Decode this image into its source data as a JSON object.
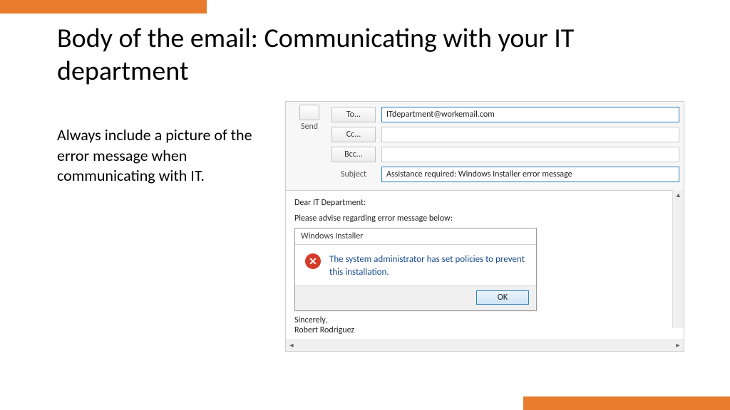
{
  "slide": {
    "title": "Body of the email: Communicating with your IT department",
    "body": "Always include a picture of the error message when communicating with IT."
  },
  "email": {
    "send_label": "Send",
    "to_label": "To...",
    "cc_label": "Cc...",
    "bcc_label": "Bcc...",
    "subject_label": "Subject",
    "to_value": "ITdepartment@workemail.com",
    "cc_value": "",
    "bcc_value": "",
    "subject_value": "Assistance required: Windows Installer error message",
    "body_line1": "Dear IT Department:",
    "body_line2": "Please advise regarding error message below:",
    "sign1": "Sincerely,",
    "sign2": "Robert Rodriguez"
  },
  "error": {
    "title": "Windows Installer",
    "message": "The system administrator has set policies to prevent this installation.",
    "ok": "OK"
  }
}
